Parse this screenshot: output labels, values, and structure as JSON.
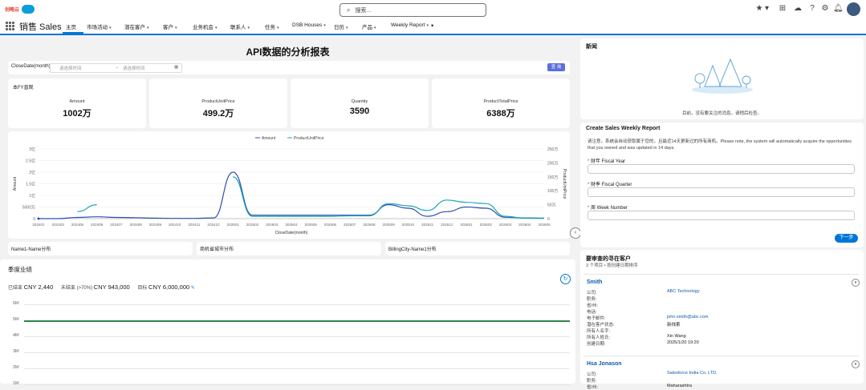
{
  "header": {
    "logo_text": "创略云",
    "search_placeholder": "搜索...",
    "icons": [
      "favorites-icon",
      "add-icon",
      "setup-assistant-icon",
      "help-icon",
      "settings-icon",
      "notifications-icon"
    ]
  },
  "nav": {
    "app_name": "销售 Sales",
    "items": [
      {
        "label": "主页",
        "caret": false
      },
      {
        "label": "市场活动",
        "caret": true
      },
      {
        "label": "潜在客户",
        "caret": true
      },
      {
        "label": "客户",
        "caret": true
      },
      {
        "label": "业务机会",
        "caret": true
      },
      {
        "label": "联系人",
        "caret": true
      },
      {
        "label": "任务",
        "caret": true
      },
      {
        "label": "DSB Houses",
        "caret": true
      },
      {
        "label": "日历",
        "caret": true
      },
      {
        "label": "产品",
        "caret": true
      },
      {
        "label": "Weekly Report",
        "caret": true
      }
    ],
    "more_caret": "▾"
  },
  "dashboard": {
    "title": "API数据的分析报表",
    "filter": {
      "label": "CloseDate(month)",
      "start_placeholder": "请选择时间",
      "arrow": "→",
      "end_placeholder": "请选择时间",
      "button_label": "查 询"
    },
    "kpi_section_title": "本FY直观",
    "kpis": [
      {
        "label": "Amount",
        "value": "1002万"
      },
      {
        "label": "ProductUnitPrice",
        "value": "499.2万"
      },
      {
        "label": "Quantity",
        "value": "3590"
      },
      {
        "label": "ProductTotalPrice",
        "value": "6388万"
      }
    ],
    "sub_cards": [
      "Name1-Name分布",
      "商机省城市分布",
      "BillingCity-Name1分布"
    ],
    "performance": {
      "title": "季度业绩",
      "closed_label": "已结束",
      "closed_value": "CNY 2,440",
      "open_label": "未结束 (>70%)",
      "open_value": "CNY 943,000",
      "target_label": "目标",
      "target_value": "CNY 6,000,000",
      "y_ticks": [
        "6M",
        "5M",
        "4M",
        "3M",
        "2M",
        "1M"
      ]
    }
  },
  "chart_data": {
    "type": "line",
    "legend": [
      "Amount",
      "ProductUnitPrice"
    ],
    "legend_position": "top-center",
    "xlabel": "CloseDate(month)",
    "ylabel": "Amount",
    "y2label": "ProductUnitPrice",
    "categories": [
      "202401",
      "202403",
      "202405",
      "202406",
      "202407",
      "202408",
      "202409",
      "202410",
      "202411",
      "202412",
      "202501",
      "202502",
      "202503",
      "202504",
      "202505",
      "202506",
      "202507",
      "202508",
      "202509",
      "202510",
      "202511",
      "202512",
      "202601",
      "202602",
      "202603",
      "202604",
      "202605"
    ],
    "y_ticks": [
      "0",
      "5000万",
      "1亿",
      "1.5亿",
      "2亿",
      "2.5亿",
      "3亿"
    ],
    "y2_ticks": [
      "0",
      "50万",
      "100万",
      "150万",
      "200万",
      "250万"
    ],
    "ylim": [
      0,
      30000
    ],
    "y2lim": [
      0,
      250
    ],
    "series": [
      {
        "name": "Amount",
        "color": "#2f4fb0",
        "axis": "left",
        "values": [
          0,
          0,
          500,
          800,
          500,
          400,
          200,
          100,
          100,
          300,
          20000,
          1500,
          1500,
          1500,
          1500,
          1500,
          1500,
          1500,
          6000,
          4500,
          1000,
          3000,
          5000,
          4500,
          600,
          300,
          200
        ]
      },
      {
        "name": "ProductUnitPrice",
        "color": "#17a6b8",
        "axis": "left",
        "values": [
          null,
          null,
          3000,
          6000,
          null,
          null,
          null,
          null,
          null,
          null,
          18000,
          1000,
          1000,
          1000,
          1000,
          1000,
          1200,
          1200,
          6500,
          5500,
          3500,
          8000,
          7000,
          6500,
          1000,
          200,
          100
        ]
      }
    ],
    "grid": true
  },
  "news_panel": {
    "title": "新闻",
    "empty_message": "目前，没有要关注的消息。请稍后检查。"
  },
  "sales_weekly": {
    "title": "Create Sales Weekly Report",
    "description": "请注意，系统会自动获取属于您的，且最近14天更新过的所有商机。Please note, the system will automatically acquire the opportunities that you owned and was updated in 14 days.",
    "fields": [
      {
        "label": "财年 Fiscal Year",
        "required": "*"
      },
      {
        "label": "财季 Fiscal Quarter",
        "required": "*"
      },
      {
        "label": "周 Week Number",
        "required": "*"
      }
    ],
    "next_label": "下一步"
  },
  "accounts": {
    "title": "要审查的寻在客户",
    "subtitle": "3 个项目 • 按创建日期排序",
    "items": [
      {
        "name": "Smith",
        "rows": [
          {
            "label": "公司:",
            "value": "ABC Technology",
            "link": true
          },
          {
            "label": "职务:",
            "value": ""
          },
          {
            "label": "省/州:",
            "value": ""
          },
          {
            "label": "电话:",
            "value": ""
          },
          {
            "label": "电子邮件:",
            "value": "john.smith@abc.com",
            "link": true
          },
          {
            "label": "潜在客户状态:",
            "value": "新线索"
          },
          {
            "label": "所有人名字:",
            "value": ""
          },
          {
            "label": "所有人姓氏:",
            "value": "Xin Wang"
          },
          {
            "label": "创建日期:",
            "value": "2025/1/20 19:20"
          }
        ]
      },
      {
        "name": "Hsa Jonason",
        "rows": [
          {
            "label": "公司:",
            "value": "Salesforce India Co. LTD.",
            "link": true
          },
          {
            "label": "职务:",
            "value": ""
          },
          {
            "label": "省/州:",
            "value": "Maharashtra"
          }
        ]
      }
    ]
  }
}
